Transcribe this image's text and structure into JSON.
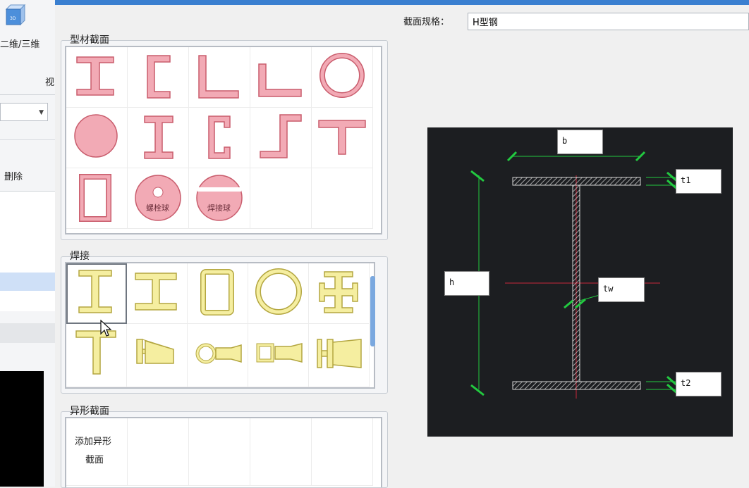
{
  "left_panel": {
    "view_mode_label": "二维/三维",
    "truncated_label": "视",
    "dropdown_value": "",
    "delete_label": "删除"
  },
  "spec": {
    "label": "截面规格：",
    "value": "H型钢"
  },
  "groups": {
    "profile": {
      "title": "型材截面",
      "items": [
        {
          "icon": "i-beam-icon"
        },
        {
          "icon": "channel-icon"
        },
        {
          "icon": "equal-angle-icon"
        },
        {
          "icon": "unequal-angle-icon"
        },
        {
          "icon": "pipe-icon"
        },
        {
          "icon": "round-bar-icon"
        },
        {
          "icon": "h-section-icon"
        },
        {
          "icon": "lipped-channel-icon"
        },
        {
          "icon": "z-section-icon"
        },
        {
          "icon": "t-section-icon"
        },
        {
          "icon": "rect-tube-icon"
        },
        {
          "icon": "bolted-ball-icon",
          "label": "螺栓球"
        },
        {
          "icon": "welded-ball-icon",
          "label": "焊接球"
        }
      ]
    },
    "welded": {
      "title": "焊接",
      "items": [
        {
          "icon": "welded-i-section-icon"
        },
        {
          "icon": "welded-h-section-icon"
        },
        {
          "icon": "welded-box-icon"
        },
        {
          "icon": "welded-circular-icon"
        },
        {
          "icon": "welded-cross-icon"
        },
        {
          "icon": "welded-t-section-icon"
        },
        {
          "icon": "tapered-i-icon"
        },
        {
          "icon": "tapered-circular-icon"
        },
        {
          "icon": "tapered-box-icon"
        },
        {
          "icon": "tapered-h-icon"
        }
      ]
    },
    "custom": {
      "title": "异形截面",
      "add_label_line1": "添加异形",
      "add_label_line2": "截面"
    }
  },
  "preview": {
    "labels": {
      "b": "b",
      "h": "h",
      "t1": "t1",
      "t2": "t2",
      "tw": "tw"
    },
    "colors": {
      "background": "#1c1e21",
      "dimension": "#22c940",
      "axis": "#c8283c",
      "section": "#d8d8d8"
    }
  },
  "colors": {
    "profile_fill": "#f2aab5",
    "profile_stroke": "#c95d6d",
    "welded_fill": "#f5eea0",
    "welded_stroke": "#b3a640",
    "accent": "#3a7fd0"
  }
}
